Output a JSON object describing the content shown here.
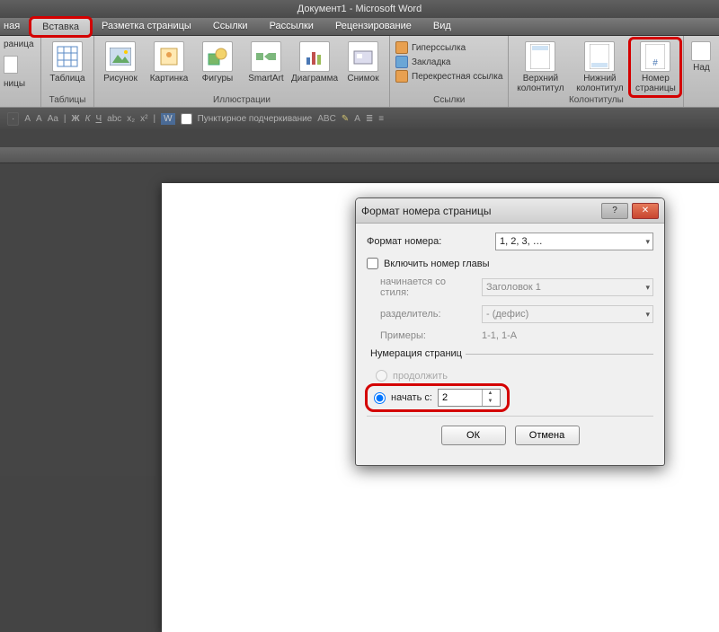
{
  "title": "Документ1 - Microsoft Word",
  "tabs": {
    "left_cut": "ная",
    "insert": "Вставка",
    "layout": "Разметка страницы",
    "refs": "Ссылки",
    "mail": "Рассылки",
    "review": "Рецензирование",
    "view": "Вид"
  },
  "ribbon": {
    "pages": {
      "label_top": "раница",
      "label_bottom": "ницы",
      "group": ""
    },
    "tables": {
      "btn": "Таблица",
      "group": "Таблицы"
    },
    "illustrations": {
      "pic": "Рисунок",
      "clip": "Картинка",
      "shapes": "Фигуры",
      "smartart": "SmartArt",
      "chart": "Диаграмма",
      "screenshot": "Снимок",
      "group": "Иллюстрации"
    },
    "links": {
      "hyperlink": "Гиперссылка",
      "bookmark": "Закладка",
      "crossref": "Перекрестная ссылка",
      "group": "Ссылки"
    },
    "headers": {
      "header": "Верхний колонтитул",
      "footer": "Нижний колонтитул",
      "pagenum": "Номер страницы",
      "group": "Колонтитулы",
      "right_cut": "Над"
    }
  },
  "minibar": {
    "dotted": "Пунктирное подчеркивание"
  },
  "dialog": {
    "title": "Формат номера страницы",
    "format_label": "Формат номера:",
    "format_value": "1, 2, 3, …",
    "include_chapter": "Включить номер главы",
    "starts_style_label": "начинается со стиля:",
    "starts_style_value": "Заголовок 1",
    "separator_label": "разделитель:",
    "separator_value": "-   (дефис)",
    "examples_label": "Примеры:",
    "examples_value": "1-1, 1-A",
    "numbering_legend": "Нумерация страниц",
    "continue": "продолжить",
    "start_at": "начать с:",
    "start_value": "2",
    "ok": "ОК",
    "cancel": "Отмена"
  }
}
